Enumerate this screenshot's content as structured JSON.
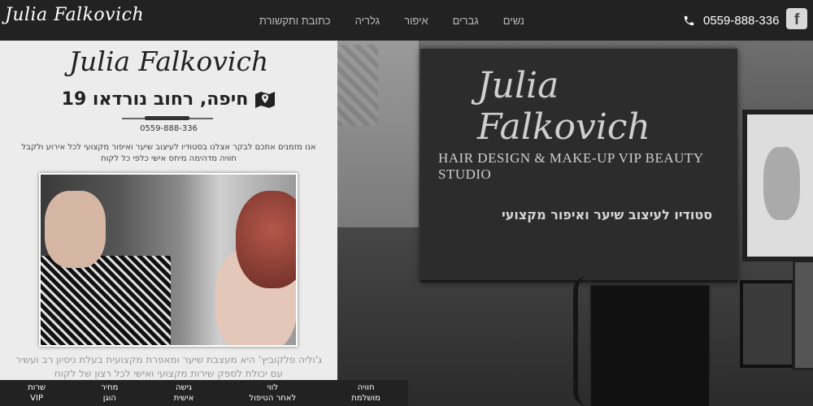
{
  "header": {
    "brand": "Julia Falkovich",
    "nav": [
      "נשים",
      "גברים",
      "איפור",
      "גלריה",
      "כתובת ותקשורת"
    ],
    "phone": "0559-888-336",
    "facebook_label": "f"
  },
  "panel": {
    "brand": "Julia Falkovich",
    "address": "חיפה, רחוב נורדאו 19",
    "phone": "0559-888-336",
    "intro": "אנו מזמנים אתכם לבקר אצלנו בסטודיו לעיצוב שיער ואיפור מקצועי לכל אירוע ולקבל חוויה מדהימה מיחס אישי כלפי כל לקוח",
    "about": "ג'וליה פלקוביץ' היא מעצבת שיער ומאפרת מקצועית בעלת ניסיון רב ועשיר עם יכולת לספק שירות מקצועי ואישי לכל רצון של לקוח"
  },
  "hero": {
    "sign_brand": "Julia Falkovich",
    "sign_sub": "HAIR DESIGN & MAKE-UP VIP BEAUTY STUDIO",
    "sign_hebrew": "סטודיו לעיצוב שיער ואיפור מקצועי"
  },
  "features": [
    {
      "line1": "חוויה",
      "line2": "מושלמת"
    },
    {
      "line1": "לווי",
      "line2": "לאחר הטיפול"
    },
    {
      "line1": "גישה",
      "line2": "אישית"
    },
    {
      "line1": "מחיר",
      "line2": "הוגן"
    },
    {
      "line1": "שרות",
      "line2": "VIP"
    }
  ],
  "colors": {
    "topbar": "#222222",
    "panel": "#ececec",
    "accent": "#333333"
  }
}
